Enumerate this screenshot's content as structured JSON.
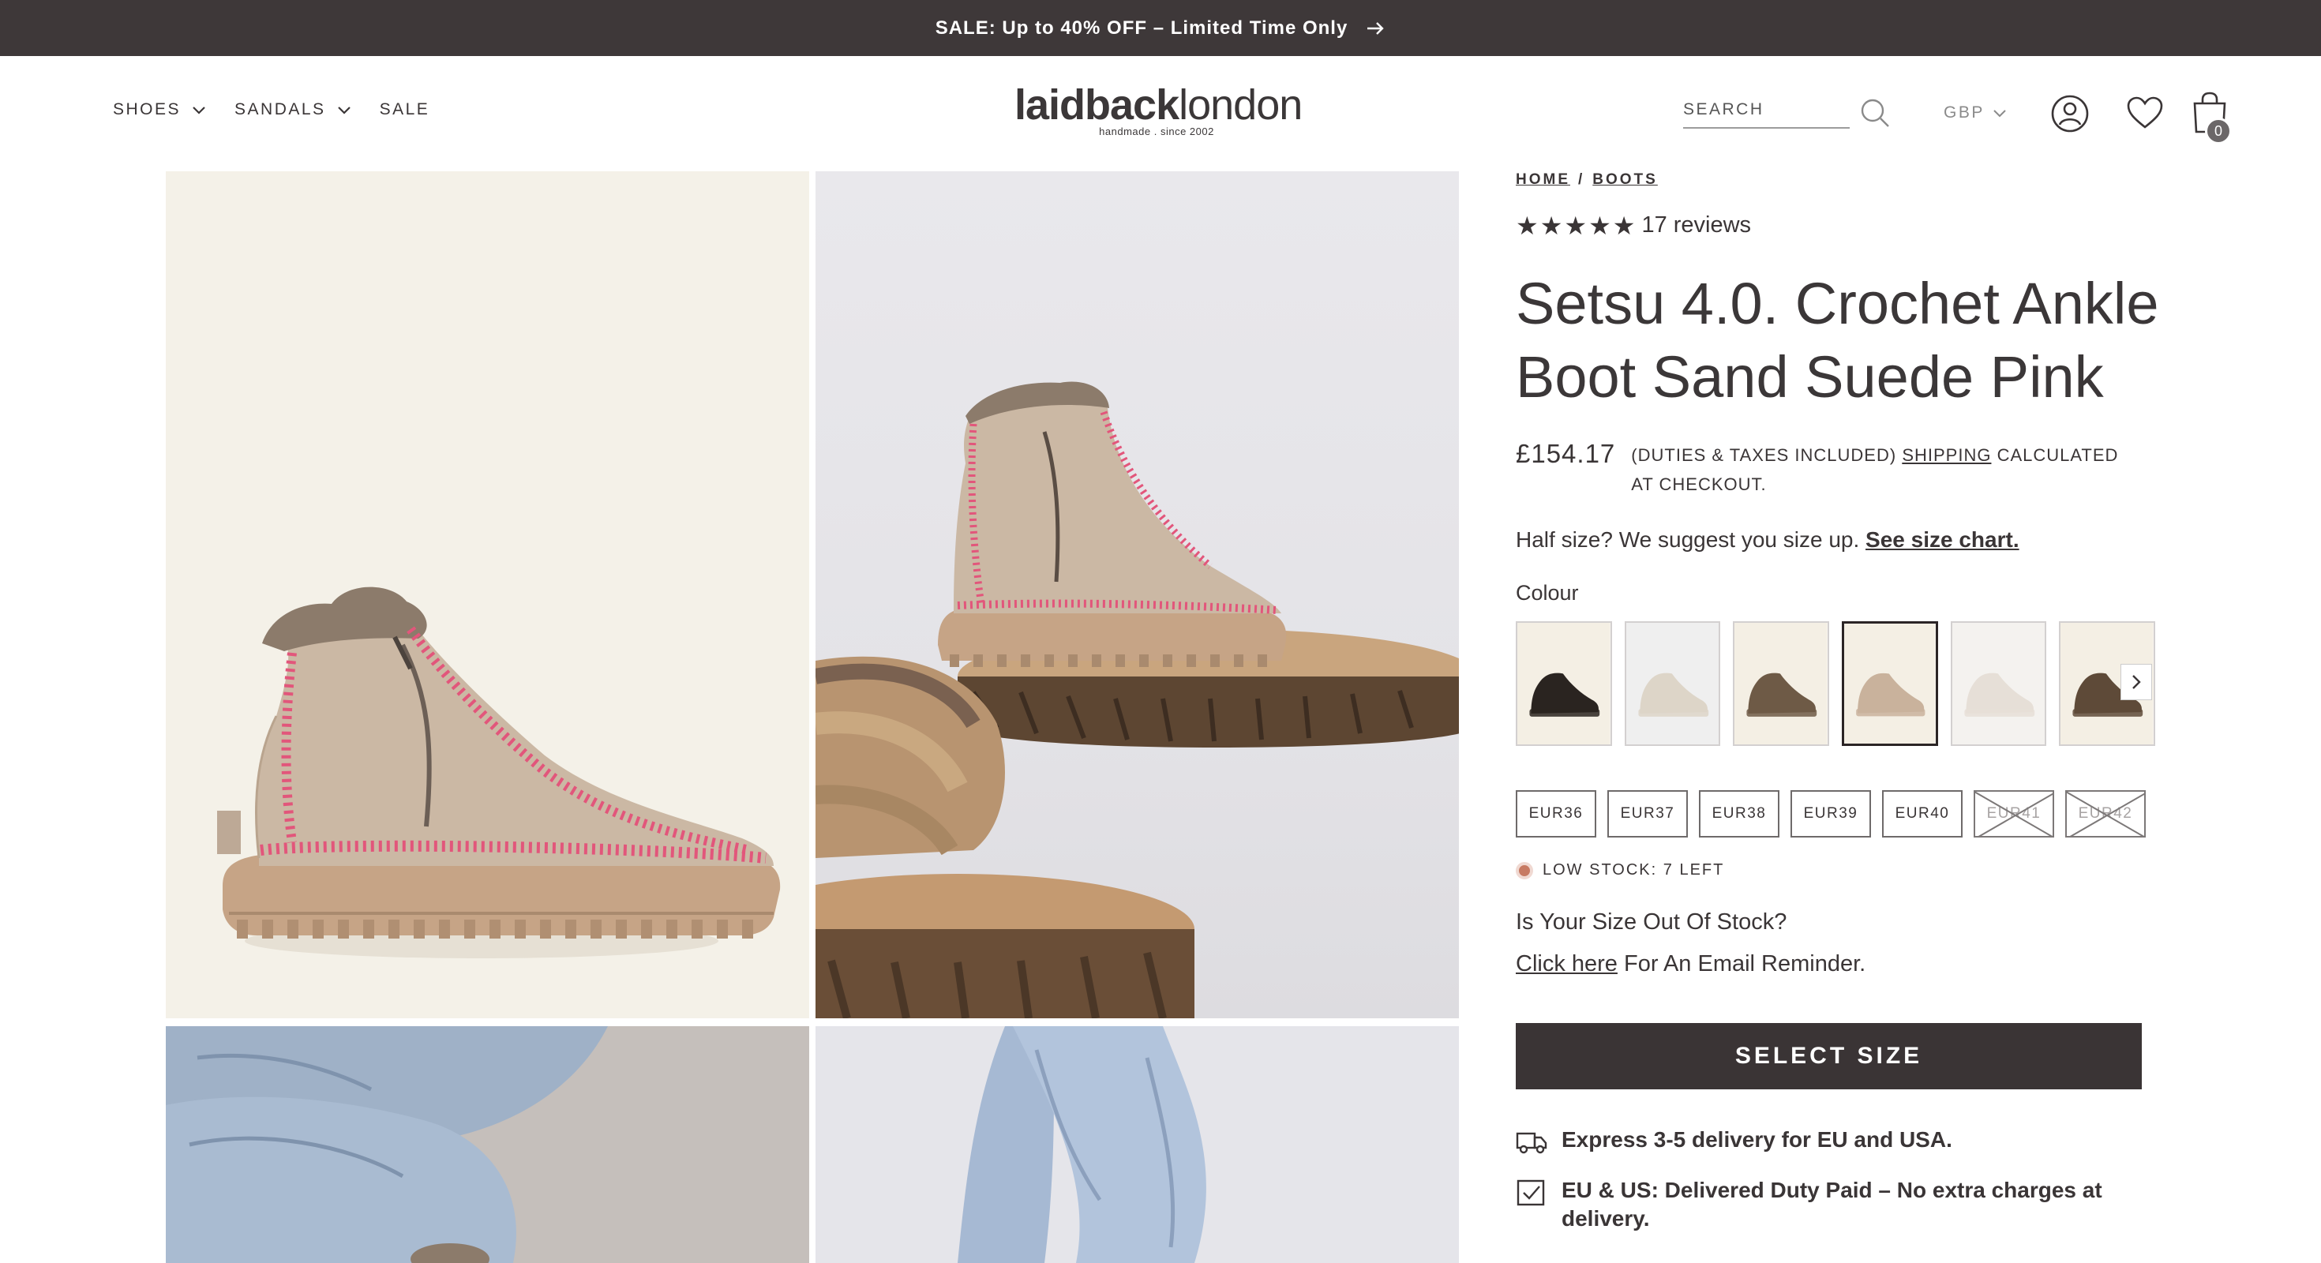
{
  "announcement": {
    "text": "SALE: Up to 40% OFF – Limited Time Only",
    "icon": "arrow-right-icon"
  },
  "nav": {
    "items": [
      {
        "label": "SHOES",
        "has_dropdown": true
      },
      {
        "label": "SANDALS",
        "has_dropdown": true
      },
      {
        "label": "SALE",
        "has_dropdown": false
      }
    ]
  },
  "logo": {
    "bold": "laidback",
    "light": "london",
    "tagline": "handmade . since 2002"
  },
  "search": {
    "placeholder": "SEARCH"
  },
  "currency": {
    "selected": "GBP"
  },
  "cart": {
    "count": "0"
  },
  "breadcrumb": {
    "home": "HOME",
    "separator": "/",
    "current": "BOOTS"
  },
  "rating": {
    "stars": 5,
    "reviews": "17 reviews"
  },
  "product": {
    "title": "Setsu 4.0. Crochet Ankle Boot Sand Suede Pink",
    "price": "£154.17",
    "tax_note_before": "(DUTIES & TAXES INCLUDED) ",
    "tax_note_link": "SHIPPING",
    "tax_note_after": " CALCULATED AT CHECKOUT."
  },
  "size_hint": {
    "text": "Half size? We suggest you size up. ",
    "link": "See size chart."
  },
  "colour": {
    "label": "Colour",
    "swatches": [
      {
        "name": "black",
        "bg": "#f4efe4",
        "boot": "#2a2420"
      },
      {
        "name": "cream-lifestyle",
        "bg": "#efefef",
        "boot": "#ddd5c8"
      },
      {
        "name": "brown",
        "bg": "#f4efe4",
        "boot": "#6e5a46"
      },
      {
        "name": "sand-pink",
        "bg": "#f4efe4",
        "boot": "#c9b29c",
        "selected": true
      },
      {
        "name": "off-white",
        "bg": "#f4f2ef",
        "boot": "#e6dfd7"
      },
      {
        "name": "dark-brown",
        "bg": "#f4efe4",
        "boot": "#5e4a38"
      }
    ]
  },
  "sizes": [
    {
      "label": "EUR36",
      "available": true
    },
    {
      "label": "EUR37",
      "available": true
    },
    {
      "label": "EUR38",
      "available": true
    },
    {
      "label": "EUR39",
      "available": true
    },
    {
      "label": "EUR40",
      "available": true
    },
    {
      "label": "EUR41",
      "available": false
    },
    {
      "label": "EUR42",
      "available": false
    }
  ],
  "stock": {
    "text": "LOW STOCK: 7 LEFT",
    "color": "#c77a63"
  },
  "out_of_stock": {
    "question": "Is Your Size Out Of Stock?",
    "link": "Click here",
    "after_link": " For An Email Reminder."
  },
  "cta": {
    "label": "SELECT SIZE"
  },
  "perks": [
    {
      "icon": "truck-icon",
      "text": "Express 3-5 delivery for EU and USA."
    },
    {
      "icon": "checkbox-icon",
      "text": "EU & US: Delivered Duty Paid – No extra charges at delivery."
    }
  ]
}
